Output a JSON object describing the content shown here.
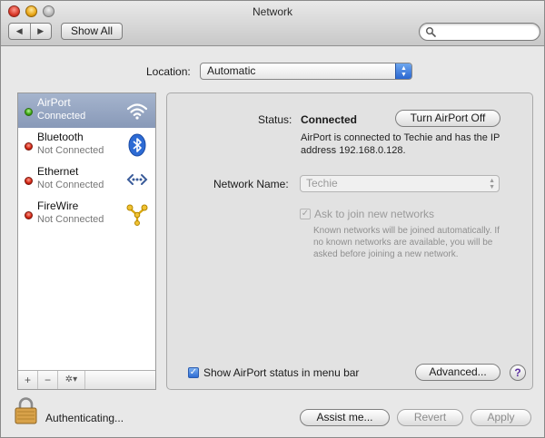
{
  "window": {
    "title": "Network",
    "nav_back": "◀",
    "nav_forward": "▶",
    "show_all": "Show All",
    "search_placeholder": ""
  },
  "location": {
    "label": "Location:",
    "value": "Automatic"
  },
  "services": [
    {
      "name": "AirPort",
      "status": "Connected",
      "indicator": "green",
      "icon": "wifi-icon",
      "selected": true
    },
    {
      "name": "Bluetooth",
      "status": "Not Connected",
      "indicator": "red",
      "icon": "bluetooth-icon",
      "selected": false
    },
    {
      "name": "Ethernet",
      "status": "Not Connected",
      "indicator": "red",
      "icon": "ethernet-icon",
      "selected": false
    },
    {
      "name": "FireWire",
      "status": "Not Connected",
      "indicator": "red",
      "icon": "firewire-icon",
      "selected": false
    }
  ],
  "sidebar_footer": {
    "add": "+",
    "remove": "−",
    "action": "✲▾"
  },
  "detail": {
    "status_label": "Status:",
    "status_value": "Connected",
    "toggle_button": "Turn AirPort Off",
    "status_description": "AirPort is connected to Techie and has the IP address 192.168.0.128.",
    "network_name_label": "Network Name:",
    "network_name_value": "Techie",
    "ask_to_join_label": "Ask to join new networks",
    "ask_to_join_checked": true,
    "ask_to_join_description": "Known networks will be joined automatically. If no known networks are available, you will be asked before joining a new network.",
    "show_status_label": "Show AirPort status in menu bar",
    "show_status_checked": true,
    "advanced_button": "Advanced...",
    "help_button": "?"
  },
  "bottom": {
    "auth_text": "Authenticating...",
    "assist_button": "Assist me...",
    "revert_button": "Revert",
    "apply_button": "Apply"
  },
  "colors": {
    "selection": "#8899b8",
    "connected": "#3aa510",
    "not_connected": "#d0210f",
    "accent": "#2e6cd3"
  }
}
